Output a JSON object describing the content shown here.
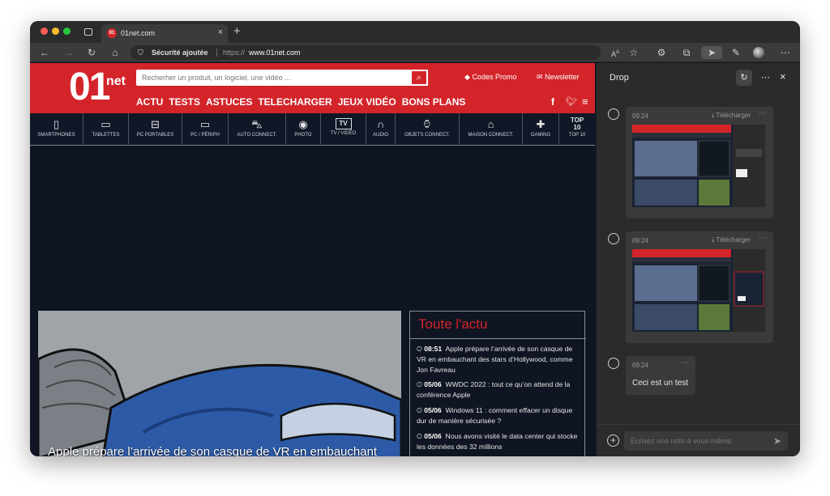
{
  "browser": {
    "tab_title": "01net.com",
    "tab_favicon": "01",
    "security_label": "Sécurité ajoutée",
    "url_prefix": "https://",
    "url_domain": "www.01net.com"
  },
  "site": {
    "logo_main": "01",
    "logo_sub": "net",
    "search_placeholder": "Recherher un produit, un logiciel, une vidéo ...",
    "codes_promo": "Codes Promo",
    "newsletter": "Newsletter",
    "nav": [
      "ACTU",
      "TESTS",
      "ASTUCES",
      "TELECHARGER",
      "JEUX VIDÉO",
      "BONS PLANS"
    ],
    "categories": [
      "SMARTPHONES",
      "TABLETTES",
      "PC PORTABLES",
      "PC / PÉRIPH",
      "AUTO CONNECT.",
      "PHOTO",
      "TV / VIDÉO",
      "AUDIO",
      "OBJETS CONNECT.",
      "MAISON CONNECT.",
      "GAMING",
      "TOP 10"
    ],
    "top10_icon_label": "TOP 10",
    "tv_icon_label": "TV",
    "hero_title": "Apple prépare l’arrivée de son casque de VR en embauchant",
    "actu_title": "Toute l'actu",
    "news": [
      {
        "time": "08:51",
        "text": "Apple prépare l’arrivée de son casque de VR en embauchant des stars d’Hollywood, comme Jon Favreau"
      },
      {
        "time": "05/06",
        "text": "WWDC 2022 : tout ce qu’on attend de la conférence Apple"
      },
      {
        "time": "05/06",
        "text": "Windows 11 : comment effacer un disque dur de manière sécurisée ?"
      },
      {
        "time": "05/06",
        "text": "Nous avons visité le data center qui stocke les données des 32 millions"
      }
    ]
  },
  "drop": {
    "title": "Drop",
    "messages": [
      {
        "time": "09:24",
        "download": "Télécharger"
      },
      {
        "time": "09:24",
        "download": "Télécharger"
      },
      {
        "time": "09:24",
        "text": "Ceci est un test"
      }
    ],
    "compose_placeholder": "Écrivez une note à vous-même."
  },
  "colors": {
    "brand_red": "#d3242a",
    "site_bg": "#0f1522",
    "panel_bg": "#2b2b2b"
  }
}
